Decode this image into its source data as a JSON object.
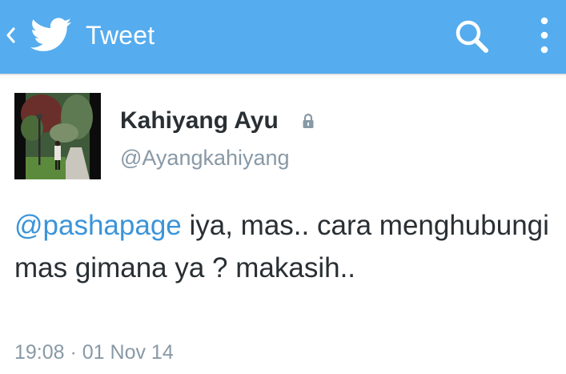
{
  "header": {
    "title": "Tweet",
    "back_icon": "chevron-left-icon",
    "logo_icon": "twitter-bird-icon",
    "search_icon": "search-icon",
    "menu_icon": "vertical-dots-icon",
    "background_color": "#55acee"
  },
  "tweet": {
    "author": {
      "display_name": "Kahiyang Ayu",
      "handle": "@Ayangkahiyang",
      "protected_icon": "lock-icon"
    },
    "mention": "@pashapage",
    "text": " iya, mas.. cara menghubungi mas gimana ya ? makasih..",
    "timestamp": "19:08 · 01 Nov 14",
    "mention_color": "#3b94d9"
  }
}
